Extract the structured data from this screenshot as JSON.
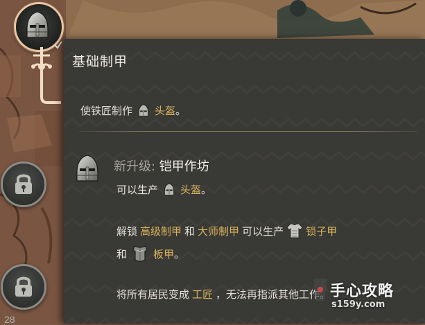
{
  "tech_tree": {
    "selected_node": {
      "name": "基础制甲",
      "icon": "helmet-icon",
      "status": "unlocked"
    },
    "locked_nodes": [
      {
        "icon": "lock-icon"
      },
      {
        "icon": "lock-icon"
      }
    ],
    "bottom_partial_text": "28"
  },
  "tooltip": {
    "title": "基础制甲",
    "description": {
      "prefix": "使铁匠制作",
      "item": "头盔",
      "suffix": "。"
    },
    "upgrade": {
      "label": "新升级:",
      "name": "铠甲作坊",
      "line1": {
        "prefix": "可以生产",
        "item": "头盔",
        "suffix": "。"
      },
      "line2": {
        "prefix": "解锁",
        "item_a": "高级制甲",
        "and": "和",
        "item_b": "大师制甲",
        "mid": "可以生产",
        "item_c": "锁子甲"
      },
      "line3": {
        "prefix": "和",
        "item": "板甲",
        "suffix": "。"
      },
      "line4": {
        "prefix": "将所有居民变成",
        "item": "工匠",
        "suffix": "，无法再指派其他工作。"
      }
    },
    "highlight_color": "#d8b35a"
  },
  "watermark": {
    "text": "手心攻略",
    "sub": "s159y.com"
  }
}
